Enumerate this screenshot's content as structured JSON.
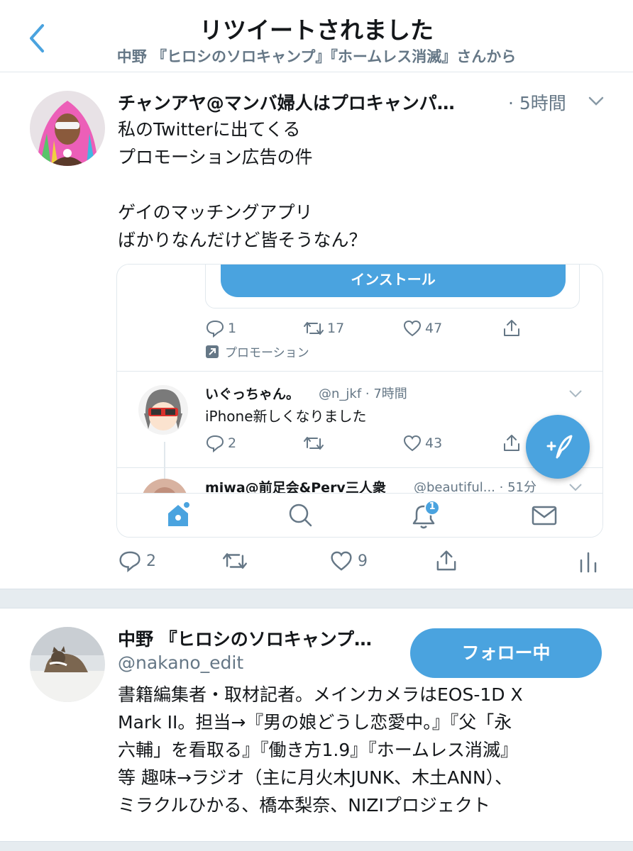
{
  "header": {
    "title": "リツイートされました",
    "subtitle": "中野 『ヒロシのソロキャンプ』『ホームレス消滅』さんから"
  },
  "tweet": {
    "author": "チャンアヤ@マンバ婦人はプロキャンパ…",
    "time": "· 5時間",
    "lines": [
      "私のTwitterに出てくる",
      "プロモーション広告の件",
      "",
      "ゲイのマッチングアプリ",
      "ばかりなんだけど皆そうなん？"
    ],
    "embed": {
      "install_label": "インストール",
      "promo_actions": {
        "reply": "1",
        "retweet": "17",
        "like": "47"
      },
      "promo_label": "プロモーション",
      "reply_tweet": {
        "name": "いぐっちゃん。",
        "meta": "@n_jkf · 7時間",
        "text": "iPhone新しくなりました",
        "reply": "2",
        "like": "43"
      },
      "next_tweet": {
        "name": "miwa@前足会&Perv三人衆",
        "meta": "@beautiful... · 51分"
      },
      "notification_badge": "1"
    },
    "actions": {
      "reply": "2",
      "retweet": "",
      "like": "9"
    }
  },
  "profile": {
    "name": "中野 『ヒロシのソロキャンプ…",
    "handle": "@nakano_edit",
    "follow_label": "フォロー中",
    "bio": [
      "書籍編集者・取材記者。メインカメラはEOS-1D X",
      "Mark II。担当→『男の娘どうし恋愛中。』『父「永",
      "六輔」を看取る』『働き方1.9』『ホームレス消滅』",
      "等 趣味→ラジオ（主に月火木JUNK、木土ANN）、",
      "ミラクルひかる、橋本梨奈、NIZIプロジェクト"
    ]
  },
  "colors": {
    "accent": "#4aa3df",
    "secondary_text": "#657786",
    "separator": "#e6ecf0"
  },
  "icons": [
    "back-chevron-icon",
    "chevron-down-icon",
    "reply-icon",
    "retweet-icon",
    "like-icon",
    "share-icon",
    "analytics-icon",
    "compose-icon",
    "home-icon",
    "search-icon",
    "bell-icon",
    "mail-icon",
    "promoted-icon"
  ]
}
